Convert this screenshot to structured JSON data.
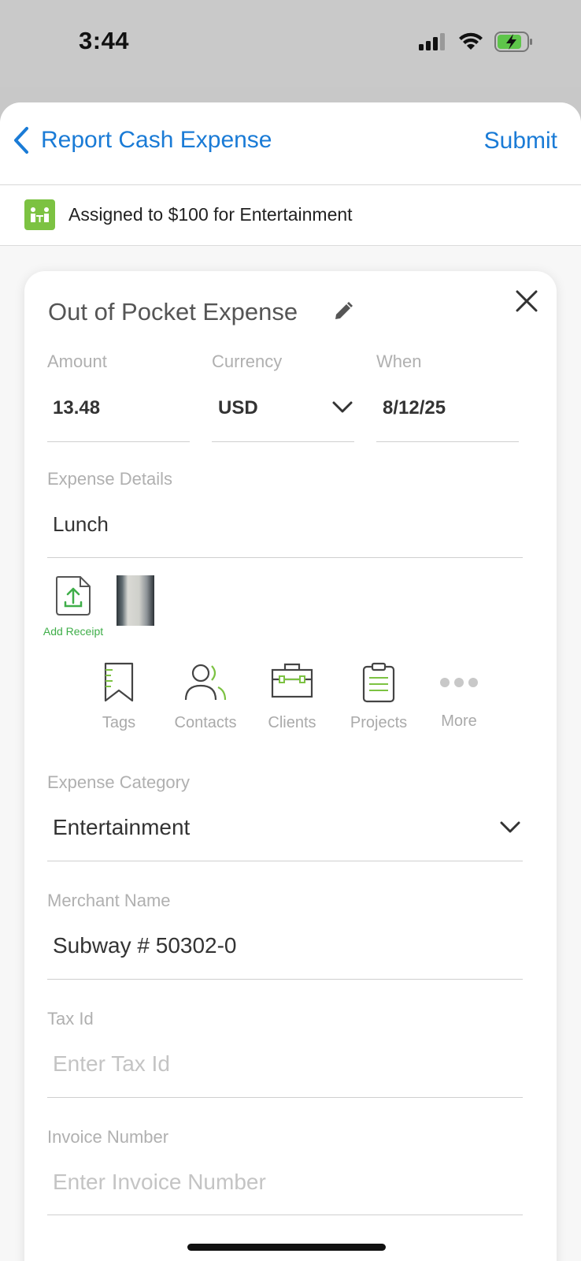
{
  "status_bar": {
    "time": "3:44"
  },
  "nav": {
    "back_label": "Report Cash Expense",
    "submit_label": "Submit"
  },
  "assignment": {
    "text": "Assigned to $100 for Entertainment"
  },
  "card": {
    "title": "Out of Pocket Expense",
    "amount": {
      "label": "Amount",
      "value": "13.48"
    },
    "currency": {
      "label": "Currency",
      "value": "USD"
    },
    "when": {
      "label": "When",
      "value": "8/12/25"
    },
    "details": {
      "label": "Expense Details",
      "value": "Lunch"
    },
    "add_receipt_label": "Add Receipt",
    "tools": [
      {
        "label": "Tags",
        "icon": "bookmark-icon"
      },
      {
        "label": "Contacts",
        "icon": "contacts-icon"
      },
      {
        "label": "Clients",
        "icon": "briefcase-icon"
      },
      {
        "label": "Projects",
        "icon": "clipboard-icon"
      },
      {
        "label": "More",
        "icon": "more-icon"
      }
    ],
    "category": {
      "label": "Expense Category",
      "value": "Entertainment"
    },
    "merchant": {
      "label": "Merchant Name",
      "value": "Subway # 50302-0"
    },
    "tax_id": {
      "label": "Tax Id",
      "placeholder": "Enter Tax Id"
    },
    "invoice": {
      "label": "Invoice Number",
      "placeholder": "Enter Invoice Number"
    }
  },
  "colors": {
    "accent_blue": "#1a7bd6",
    "brand_green": "#7cc242"
  }
}
